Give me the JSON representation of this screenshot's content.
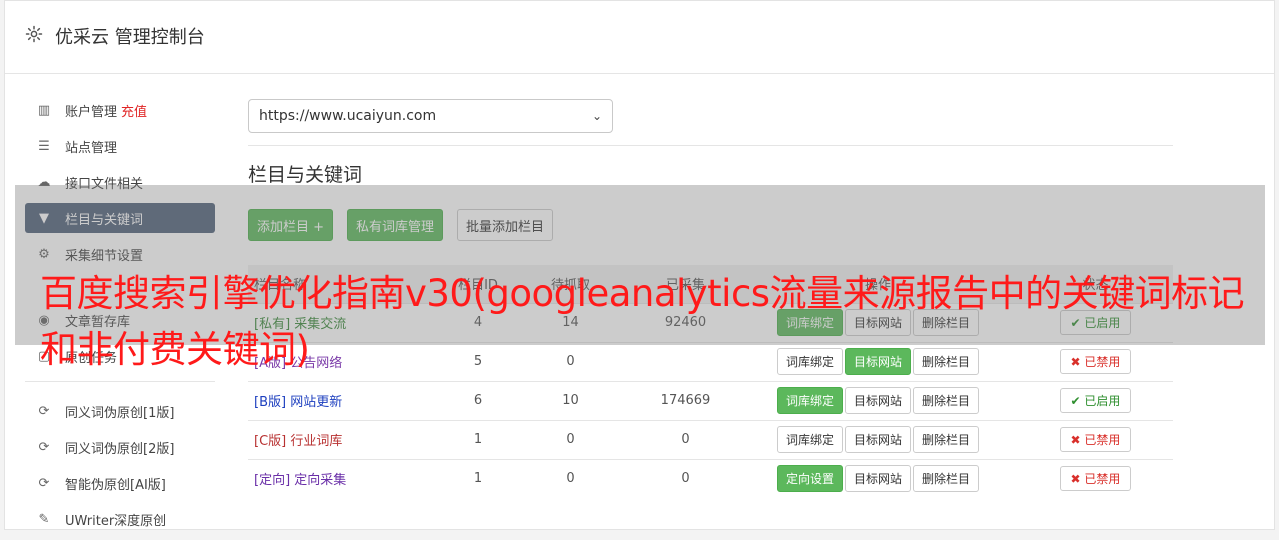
{
  "header": {
    "title": "优采云 管理控制台",
    "icon": "gear-icon"
  },
  "sidebar": {
    "items": [
      {
        "label": "账户管理",
        "badge": "充值",
        "icon": "bar-chart-icon"
      },
      {
        "label": "站点管理",
        "icon": "server-icon"
      },
      {
        "label": "接口文件相关",
        "icon": "cloud-upload-icon"
      },
      {
        "label": "栏目与关键词",
        "icon": "filter-icon",
        "active": true
      },
      {
        "label": "采集细节设置",
        "icon": "gears-icon"
      },
      {
        "label": "文章暂存库",
        "icon": "database-icon"
      },
      {
        "label": "原创任务",
        "icon": "task-icon"
      }
    ],
    "tools": [
      {
        "label": "同义词伪原创[1版]",
        "icon": "refresh-icon"
      },
      {
        "label": "同义词伪原创[2版]",
        "icon": "refresh-icon"
      },
      {
        "label": "智能伪原创[AI版]",
        "icon": "refresh-icon"
      },
      {
        "label": "UWriter深度原创",
        "icon": "edit-icon"
      }
    ]
  },
  "main": {
    "site_select": "https://www.ucaiyun.com",
    "section_title": "栏目与关键词",
    "buttons": {
      "add_column": "添加栏目 +",
      "private_lib": "私有词库管理",
      "bulk_add": "批量添加栏目"
    },
    "table": {
      "headers": [
        "栏目名称",
        "栏目ID",
        "待抓取",
        "已采集",
        "操作",
        "状态"
      ],
      "rows": [
        {
          "tag": "[私有]",
          "name": "采集交流",
          "id": "4",
          "pending": "14",
          "collected": "92460",
          "op1": "词库绑定",
          "op2": "目标网站",
          "op3": "删除栏目",
          "status": "已启用"
        },
        {
          "tag": "[A版]",
          "name": "公告网络",
          "id": "5",
          "pending": "0",
          "collected": "",
          "op1": "词库绑定",
          "op2": "目标网站",
          "op3": "删除栏目",
          "status": "已禁用"
        },
        {
          "tag": "[B版]",
          "name": "网站更新",
          "id": "6",
          "pending": "10",
          "collected": "174669",
          "op1": "词库绑定",
          "op2": "目标网站",
          "op3": "删除栏目",
          "status": "已启用"
        },
        {
          "tag": "[C版]",
          "name": "行业词库",
          "id": "1",
          "pending": "0",
          "collected": "0",
          "op1": "词库绑定",
          "op2": "目标网站",
          "op3": "删除栏目",
          "status": "已禁用"
        },
        {
          "tag": "[定向]",
          "name": "定向采集",
          "id": "1",
          "pending": "0",
          "collected": "0",
          "op1": "定向设置",
          "op2": "目标网站",
          "op3": "删除栏目",
          "status": "已禁用"
        }
      ]
    }
  },
  "overlay": {
    "text": "百度搜索引擎优化指南v30(googleanalytics流量来源报告中的关键词标记和非付费关键词)"
  }
}
